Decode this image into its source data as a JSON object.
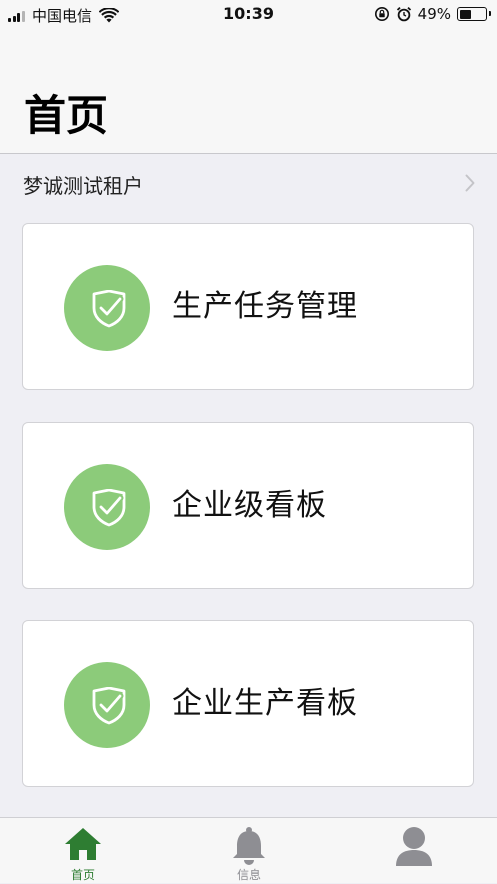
{
  "status_bar": {
    "carrier": "中国电信",
    "time": "10:39",
    "battery": "49%",
    "battery_level": 0.49,
    "signal_bars": 3,
    "icons": [
      "signal-icon",
      "wifi-icon",
      "rotation-lock-icon",
      "alarm-icon",
      "battery-icon"
    ]
  },
  "header": {
    "title": "首页"
  },
  "tenant": {
    "label": "梦诚测试租户",
    "icon": "chevron-right-icon"
  },
  "cards": [
    {
      "label": "生产任务管理",
      "icon": "shield-check-icon"
    },
    {
      "label": "企业级看板",
      "icon": "shield-check-icon"
    },
    {
      "label": "企业生产看板",
      "icon": "shield-check-icon"
    }
  ],
  "tab_bar": {
    "tabs": [
      {
        "label": "首页",
        "icon": "home-icon",
        "active": true
      },
      {
        "label": "信息",
        "icon": "bell-icon",
        "active": false
      },
      {
        "label": "",
        "icon": "profile-icon",
        "active": false
      }
    ]
  },
  "colors": {
    "background": "#efeff4",
    "accent_green": "#2e7d32",
    "icon_circle": "#8ccb7a",
    "inactive_tab": "#8e8e93"
  }
}
